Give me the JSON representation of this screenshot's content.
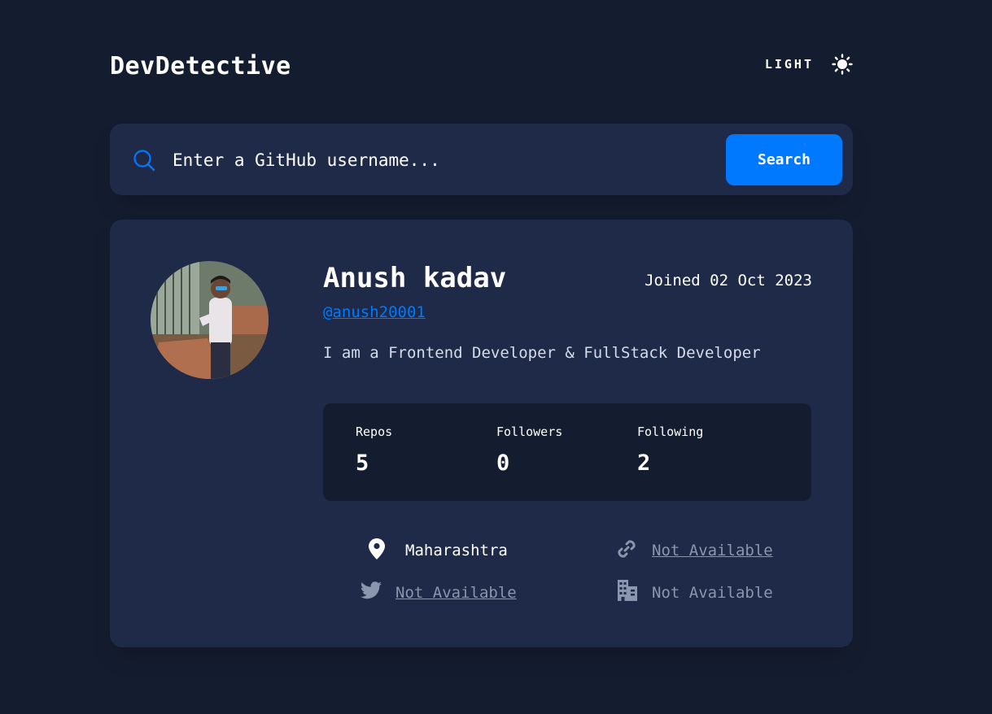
{
  "header": {
    "logo": "DevDetective",
    "mode_label": "LIGHT",
    "mode_icon": "sun-icon"
  },
  "search": {
    "placeholder": "Enter a GitHub username...",
    "value": "",
    "button_label": "Search",
    "icon": "search-icon"
  },
  "profile": {
    "name": "Anush kadav",
    "joined": "Joined 02 Oct 2023",
    "handle": "@anush20001",
    "bio": "I am a Frontend Developer & FullStack Developer",
    "stats": [
      {
        "label": "Repos",
        "value": "5"
      },
      {
        "label": "Followers",
        "value": "0"
      },
      {
        "label": "Following",
        "value": "2"
      }
    ],
    "links": {
      "location": {
        "icon": "location-pin-icon",
        "text": "Maharashtra"
      },
      "website": {
        "icon": "link-icon",
        "text": "Not Available"
      },
      "twitter": {
        "icon": "twitter-icon",
        "text": "Not Available"
      },
      "company": {
        "icon": "building-icon",
        "text": "Not Available"
      }
    }
  },
  "colors": {
    "background": "#141d2f",
    "card": "#1e2a47",
    "accent": "#0079ff",
    "muted": "#8a96ad"
  }
}
